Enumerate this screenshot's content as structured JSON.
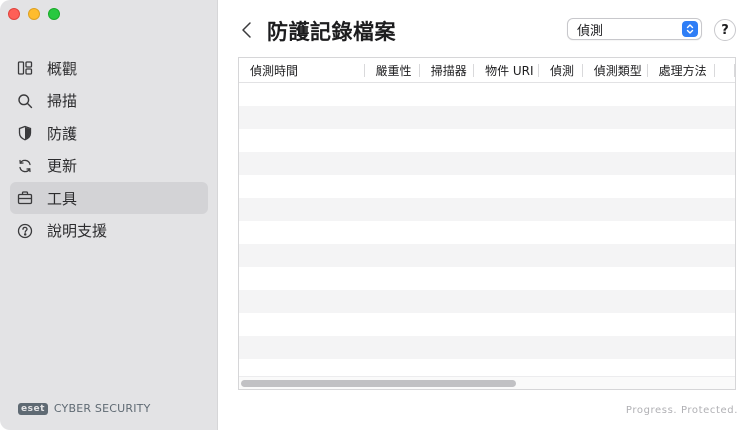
{
  "sidebar": {
    "items": [
      {
        "label": "概觀",
        "icon": "overview-icon"
      },
      {
        "label": "掃描",
        "icon": "search-icon"
      },
      {
        "label": "防護",
        "icon": "shield-icon"
      },
      {
        "label": "更新",
        "icon": "refresh-icon"
      },
      {
        "label": "工具",
        "icon": "briefcase-icon",
        "active": true
      },
      {
        "label": "說明支援",
        "icon": "help-circle-icon"
      }
    ],
    "brand_logo": "eset",
    "brand_text": "CYBER SECURITY"
  },
  "header": {
    "title": "防護記錄檔案",
    "filter_value": "偵測",
    "help_label": "?"
  },
  "table": {
    "columns": [
      "偵測時間",
      "嚴重性",
      "掃描器",
      "物件 URI",
      "偵測",
      "偵測類型",
      "處理方法"
    ],
    "rows": []
  },
  "footer": {
    "tagline": "Progress. Protected."
  },
  "colors": {
    "accent": "#2f7ef6",
    "sidebar_bg": "#e3e3e5",
    "active_item_bg": "#d3d3d6",
    "row_alt_bg": "#f4f4f5"
  }
}
